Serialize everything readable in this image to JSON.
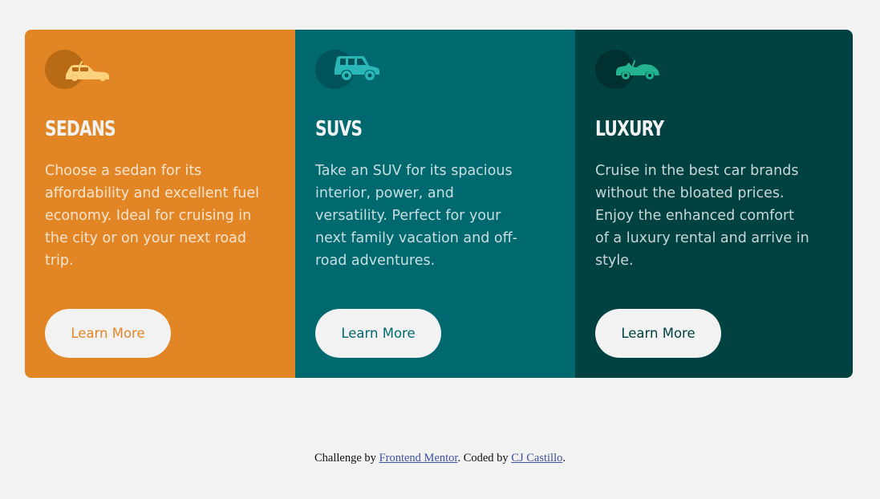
{
  "cards": [
    {
      "icon": "sedan-icon",
      "title": "SEDANS",
      "text": "Choose a sedan for its affordability and excellent fuel economy. Ideal for cruising in the city or on your next road trip.",
      "button_label": "Learn More",
      "color": "#e28625"
    },
    {
      "icon": "suv-icon",
      "title": "SUVS",
      "text": "Take an SUV for its spacious interior, power, and versatility. Perfect for your next family vacation and off-road adventures.",
      "button_label": "Learn More",
      "color": "#006970"
    },
    {
      "icon": "luxury-car-icon",
      "title": "LUXURY",
      "text": "Cruise in the best car brands without the bloated prices. Enjoy the enhanced comfort of a luxury rental and arrive in style.",
      "button_label": "Learn More",
      "color": "#004241"
    }
  ],
  "attribution": {
    "prefix": "Challenge by ",
    "link1": "Frontend Mentor",
    "middle": ". Coded by ",
    "link2": "CJ Castillo",
    "suffix": "."
  },
  "colors": {
    "background": "#f2f2f2",
    "sedan_icon": "#ffd37d",
    "suv_icon": "#2ab7b7",
    "luxury_icon": "#24b38f"
  }
}
